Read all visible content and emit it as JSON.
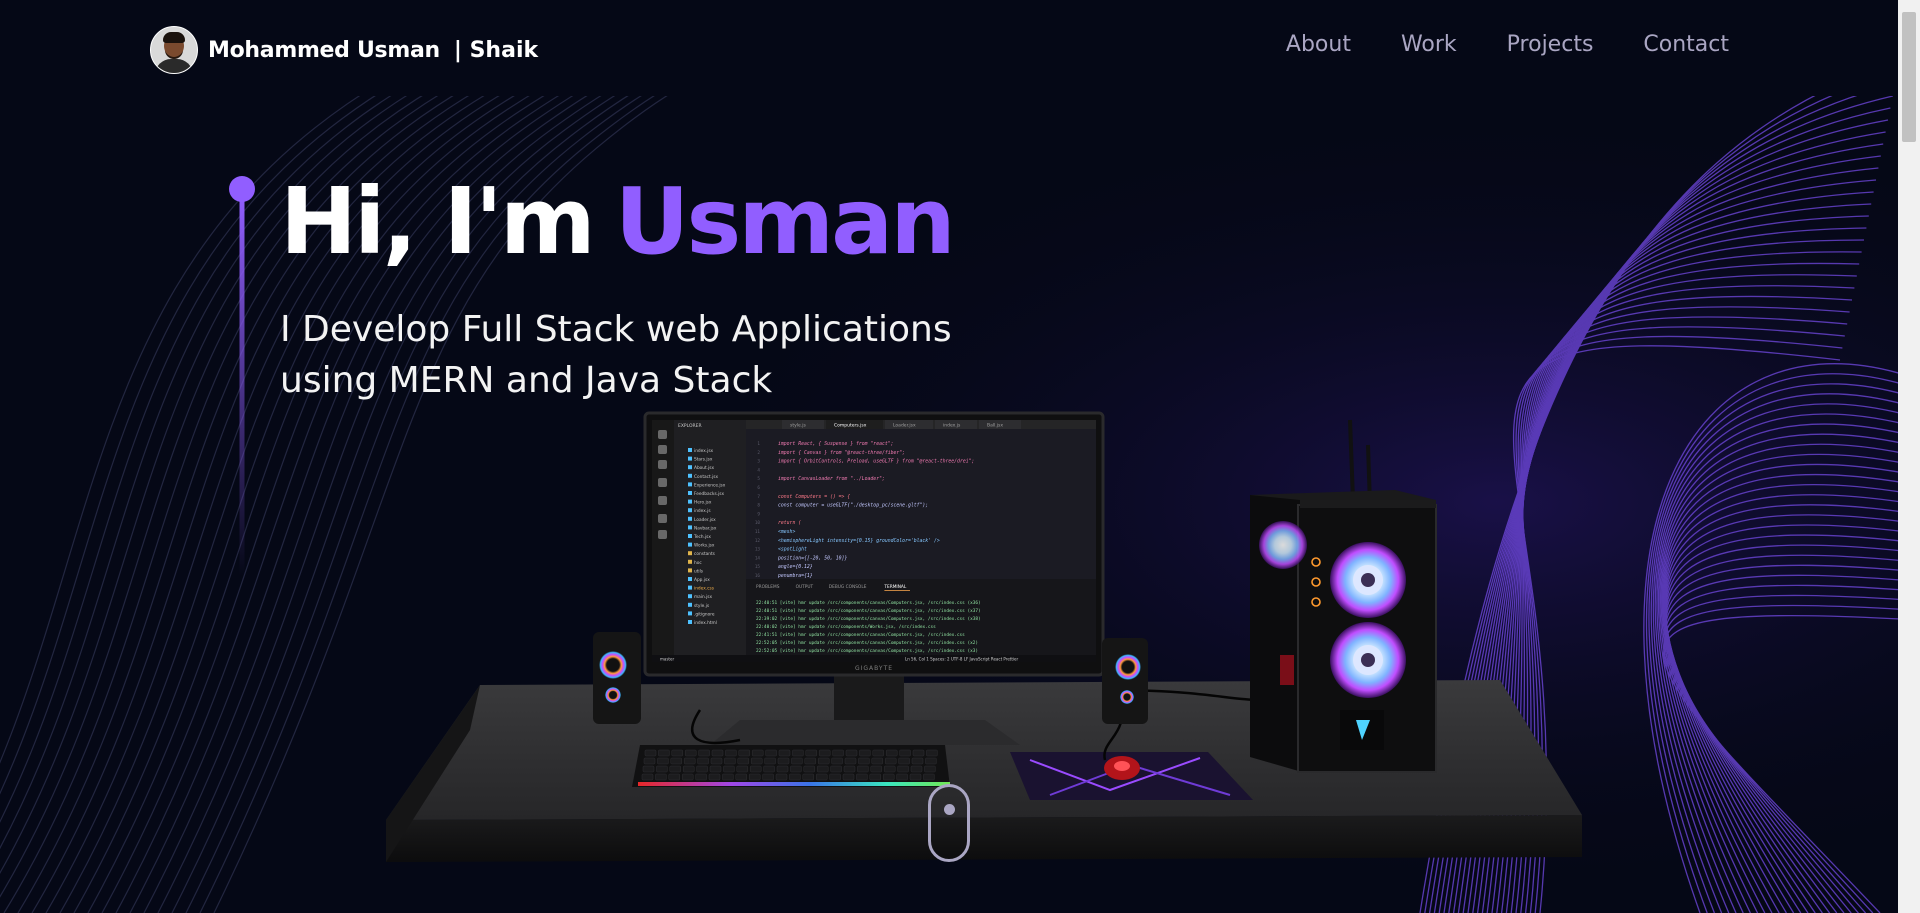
{
  "nav": {
    "brand_name": "Mohammed Usman",
    "brand_suffix": "| Shaik",
    "links": [
      "About",
      "Work",
      "Projects",
      "Contact"
    ]
  },
  "hero": {
    "greeting": "Hi, I'm",
    "name": "Usman",
    "subtitle_line1": "I Develop Full Stack web Applications",
    "subtitle_line2": "using MERN and Java Stack"
  },
  "monitor": {
    "brand": "GIGABYTE",
    "tabs": [
      "style.js",
      "Computers.jsx",
      "Loader.jsx",
      "index.js",
      "Ball.jsx"
    ],
    "explorer_title": "EXPLORER",
    "explorer_files": [
      "index.jsx",
      "Stars.jsx",
      "About.jsx",
      "Contact.jsx",
      "Experience.jsx",
      "Feedbacks.jsx",
      "Hero.jsx",
      "index.js",
      "Loader.jsx",
      "Navbar.jsx",
      "Tech.jsx",
      "Works.jsx",
      "constants",
      "hoc",
      "utils",
      "App.jsx",
      "index.css",
      "main.jsx",
      "style.js",
      ".gitignore",
      "index.html"
    ],
    "code_lines": [
      "import React, { Suspense } from \"react\";",
      "import { Canvas } from \"@react-three/fiber\";",
      "import { OrbitControls, Preload, useGLTF } from \"@react-three/drei\";",
      "",
      "import CanvasLoader from \"../Loader\";",
      "",
      "const Computers = () => {",
      "  const computer = useGLTF(\"./desktop_pc/scene.gltf\");",
      "",
      "  return (",
      "    <mesh>",
      "      <hemisphereLight intensity={0.15} groundColor='black' />",
      "      <spotLight",
      "        position={[-20, 50, 10]}",
      "        angle={0.12}",
      "        penumbra={1}"
    ],
    "terminal_tabs": [
      "PROBLEMS",
      "OUTPUT",
      "DEBUG CONSOLE",
      "TERMINAL"
    ],
    "terminal_lines": [
      "22:40:51 [vite] hmr update /src/components/canvas/Computers.jsx, /src/index.css (x36)",
      "22:40:51 [vite] hmr update /src/components/canvas/Computers.jsx, /src/index.css (x37)",
      "22:39:02 [vite] hmr update /src/components/canvas/Computers.jsx, /src/index.css (x38)",
      "22:40:02 [vite] hmr update /src/components/Works.jsx, /src/index.css",
      "22:41:51 [vite] hmr update /src/components/canvas/Computers.jsx, /src/index.css",
      "22:52:05 [vite] hmr update /src/components/canvas/Computers.jsx, /src/index.css (x2)",
      "22:52:05 [vite] hmr update /src/components/canvas/Computers.jsx, /src/index.css (x3)"
    ],
    "status_left": "master",
    "status_right": "Ln 56, Col 1   Spaces: 2   UTF-8   LF   JavaScript React   Prettier"
  },
  "colors": {
    "background": "#050816",
    "accent": "#915eff",
    "nav_text": "#aaa6c3",
    "white": "#ffffff"
  },
  "icons": [
    "avatar-photo",
    "mouse-scroll-icon",
    "vscode-activity-icons"
  ]
}
